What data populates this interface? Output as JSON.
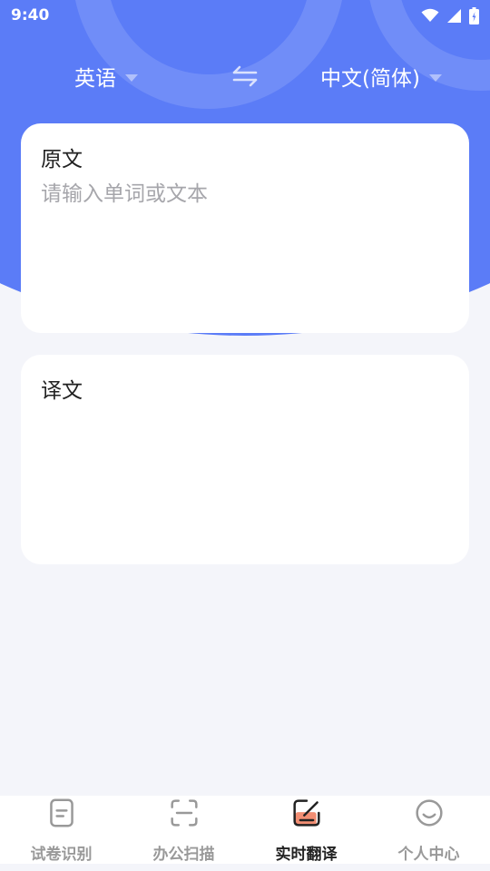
{
  "status_bar": {
    "time": "9:40"
  },
  "language_bar": {
    "source_language": "英语",
    "target_language": "中文(简体)"
  },
  "source_card": {
    "title": "原文",
    "placeholder": "请输入单词或文本",
    "value": ""
  },
  "target_card": {
    "title": "译文",
    "value": ""
  },
  "tabbar": {
    "tabs": [
      {
        "label": "试卷识别",
        "icon": "document-icon",
        "active": false
      },
      {
        "label": "办公扫描",
        "icon": "scan-frame-icon",
        "active": false
      },
      {
        "label": "实时翻译",
        "icon": "translate-edit-icon",
        "active": true
      },
      {
        "label": "个人中心",
        "icon": "smiley-icon",
        "active": false
      }
    ]
  },
  "colors": {
    "header_blue": "#5b7cf7",
    "page_background": "#f4f5fa",
    "active_tab_accent": "#f07a5a",
    "inactive_tab": "#999999"
  }
}
